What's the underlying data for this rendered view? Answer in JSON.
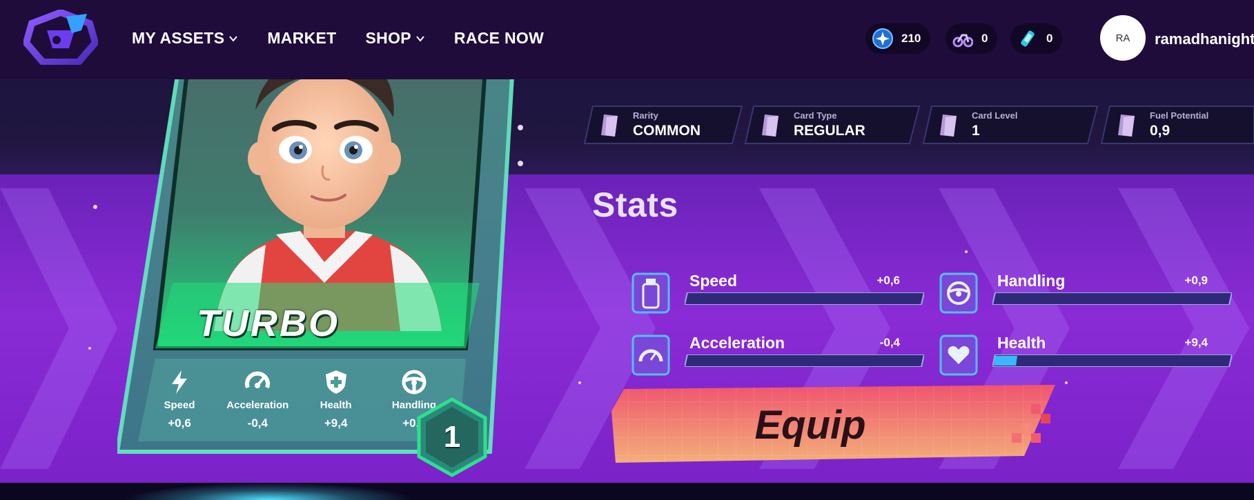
{
  "colors": {
    "nav_bg": "#1f0c3b",
    "band_purple": "#8a2bd6",
    "card_green": "#2dd4a0",
    "bar_fill": "#3ab8ff",
    "equip_pink": "#f06a7a",
    "equip_orange": "#f2a46a"
  },
  "nav": {
    "logo_icon": "rocket-shield-logo",
    "menu": [
      {
        "label": "MY ASSETS",
        "has_dropdown": true
      },
      {
        "label": "MARKET",
        "has_dropdown": false
      },
      {
        "label": "SHOP",
        "has_dropdown": true
      },
      {
        "label": "RACE NOW",
        "has_dropdown": false
      }
    ],
    "currencies": [
      {
        "icon": "star-coin-icon",
        "value": "210"
      },
      {
        "icon": "motorbike-icon",
        "value": "0"
      },
      {
        "icon": "fuel-canister-icon",
        "value": "0"
      }
    ],
    "user": {
      "initials": "RA",
      "name": "ramadhanight"
    }
  },
  "card": {
    "name": "TURBO",
    "level": "1",
    "stats": [
      {
        "icon": "lightning-icon",
        "label": "Speed",
        "value": "+0,6"
      },
      {
        "icon": "speedometer-icon",
        "label": "Acceleration",
        "value": "-0,4"
      },
      {
        "icon": "shield-plus-icon",
        "label": "Health",
        "value": "+9,4"
      },
      {
        "icon": "steering-wheel-icon",
        "label": "Handling",
        "value": "+0,9"
      }
    ]
  },
  "info": [
    {
      "label": "Rarity",
      "value": "COMMON"
    },
    {
      "label": "Card Type",
      "value": "REGULAR"
    },
    {
      "label": "Card Level",
      "value": "1"
    },
    {
      "label": "Fuel Potential",
      "value": "0,9"
    }
  ],
  "stats_panel": {
    "title": "Stats",
    "items": [
      {
        "icon": "nitro-bottle-icon",
        "name": "Speed",
        "value": "+0,6",
        "fill": 0.0
      },
      {
        "icon": "steering-wheel-icon",
        "name": "Handling",
        "value": "+0,9",
        "fill": 0.0
      },
      {
        "icon": "gauge-icon",
        "name": "Acceleration",
        "value": "-0,4",
        "fill": 0.0
      },
      {
        "icon": "heart-icon",
        "name": "Health",
        "value": "+9,4",
        "fill": 0.094
      }
    ]
  },
  "equip": {
    "label": "Equip"
  }
}
